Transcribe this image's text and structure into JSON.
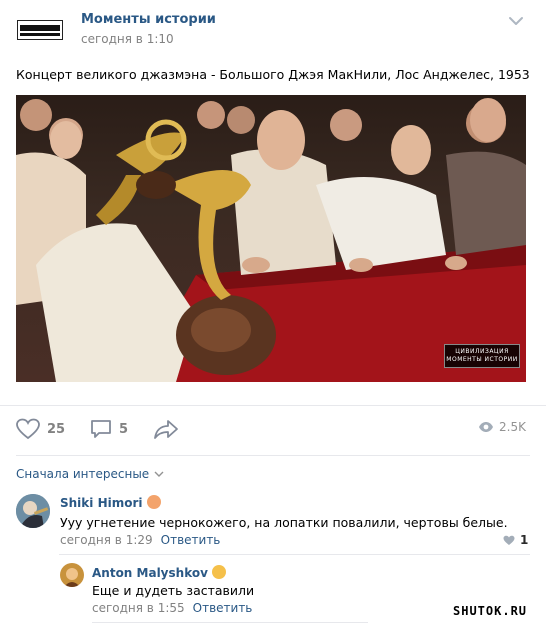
{
  "post": {
    "group_name": "Моменты истории",
    "time": "сегодня в 1:10",
    "text": "Концерт великого джазмэна - Большого Джэя МакНили, Лос Анджелес, 1953",
    "logo_line1": "ЦИВИЛИЗАЦИЯ",
    "logo_line2": "МОМЕНТЫ ИСТОРИИ",
    "photo_watermark_line1": "ЦИВИЛИЗАЦИЯ",
    "photo_watermark_line2": "МОМЕНТЫ ИСТОРИИ"
  },
  "actions": {
    "likes": "25",
    "comments": "5",
    "views": "2.5K",
    "icons": [
      "heart-icon",
      "comment-icon",
      "share-icon",
      "eye-icon"
    ]
  },
  "comments_sort": {
    "label": "Сначала интересные"
  },
  "comments": [
    {
      "author": "Shiki Himori",
      "text": "Ууу угнетение чернокожего, на лопатки повалили, чертовы белые.",
      "time": "сегодня в 1:29",
      "reply_label": "Ответить",
      "likes": "1"
    },
    {
      "author": "Anton Malyshkov",
      "text": "Еще и дудеть заставили",
      "time": "сегодня в 1:55",
      "reply_label": "Ответить"
    }
  ],
  "site_watermark": "SHUTOK.RU",
  "colors": {
    "link": "#2a5885",
    "muted": "#828282",
    "divider": "#e7e8ec",
    "carpet_red": "#a3141a"
  }
}
